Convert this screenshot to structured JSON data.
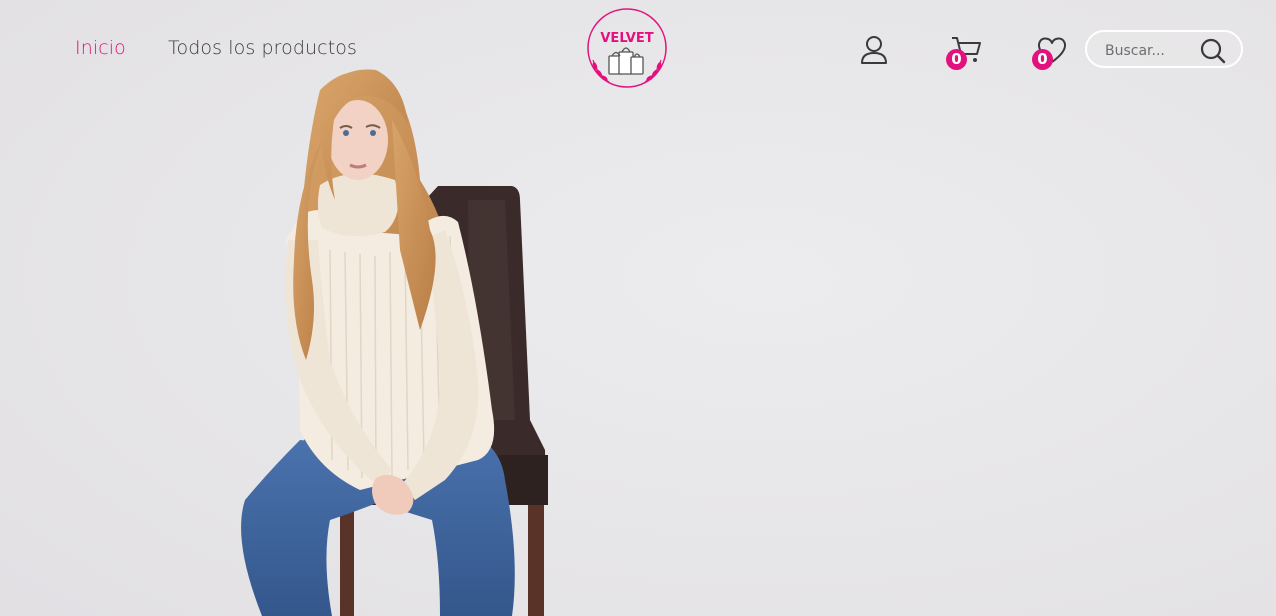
{
  "nav": {
    "home_label": "Inicio",
    "all_products_label": "Todos los productos"
  },
  "logo": {
    "text": "VELVET"
  },
  "header": {
    "cart_count": "0",
    "wishlist_count": "0",
    "search_placeholder": "Buscar..."
  },
  "colors": {
    "accent": "#e3117f",
    "text": "#3a3a3a",
    "background": "#e9e8ea"
  },
  "icons": [
    "user-icon",
    "cart-icon",
    "heart-icon",
    "search-icon"
  ]
}
